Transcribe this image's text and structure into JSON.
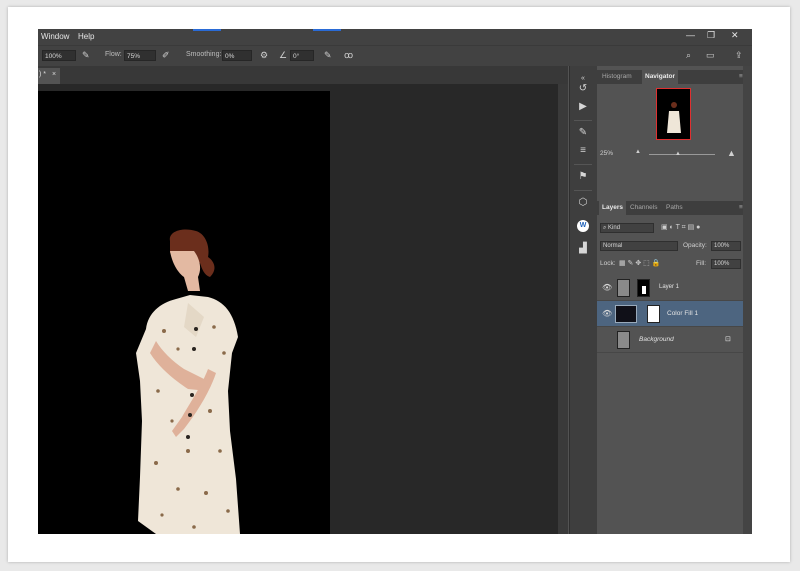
{
  "menu": {
    "items": [
      "Window",
      "Help"
    ],
    "window_controls": [
      "—",
      "❐",
      "✕"
    ]
  },
  "options_bar": {
    "zoom_value": "100%",
    "flow_label": "Flow:",
    "flow_value": "75%",
    "smoothing_label": "Smoothing:",
    "smoothing_value": "0%",
    "angle_value": "0°"
  },
  "document_tab": {
    "label": ") *",
    "close": "×"
  },
  "panels": {
    "top_tabs": [
      "Histogram",
      "Navigator"
    ],
    "navigator_zoom": "25%",
    "layers_tabs": [
      "Layers",
      "Channels",
      "Paths"
    ],
    "filter_kind": "Kind",
    "blend_mode": "Normal",
    "opacity_label": "Opacity:",
    "opacity_value": "100%",
    "lock_label": "Lock:",
    "fill_label": "Fill:",
    "fill_value": "100%",
    "layers": [
      {
        "name": "Layer 1",
        "selected": false
      },
      {
        "name": "Color Fill 1",
        "selected": true
      },
      {
        "name": "Background",
        "selected": false
      }
    ]
  },
  "colors": {
    "accent": "#2a6bd6",
    "selected_layer": "#4d6580",
    "navigator_frame": "#e03030"
  }
}
